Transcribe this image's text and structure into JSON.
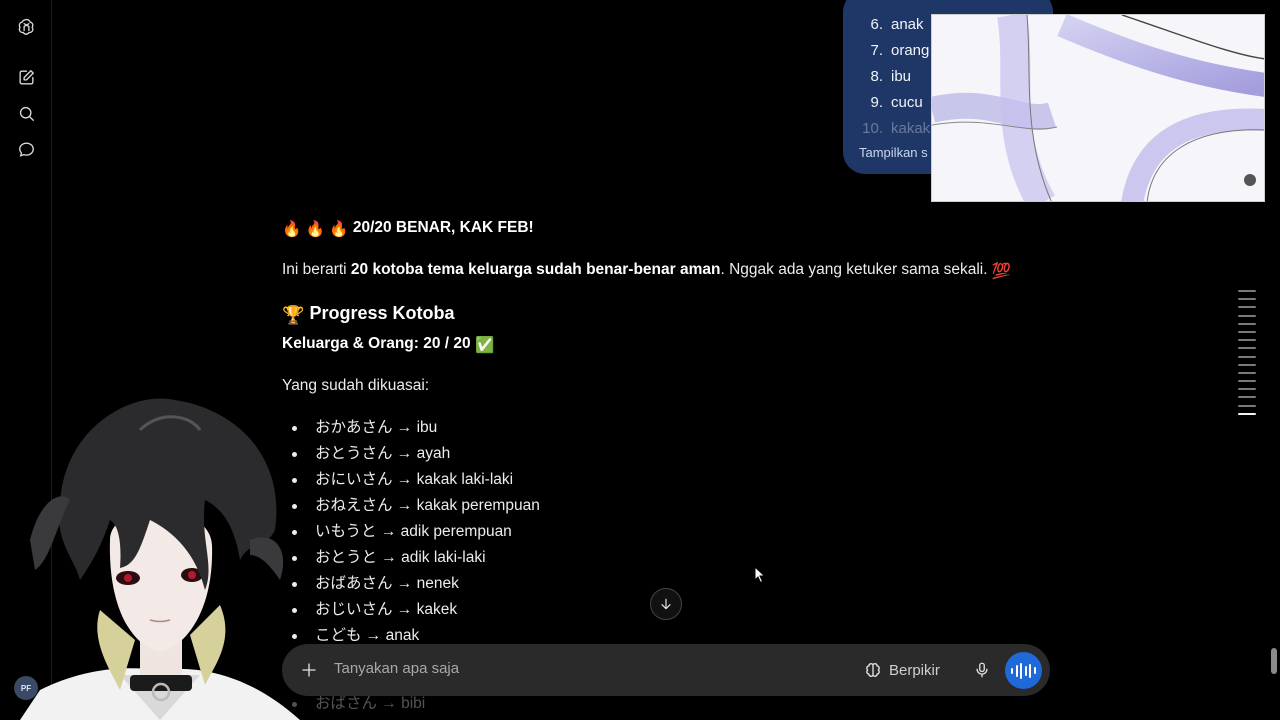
{
  "user_message": {
    "items": [
      {
        "n": "6.",
        "text": "anak"
      },
      {
        "n": "7.",
        "text": "orang t"
      },
      {
        "n": "8.",
        "text": "ibu"
      },
      {
        "n": "9.",
        "text": "cucu"
      },
      {
        "n": "10.",
        "text": "kakak l"
      }
    ],
    "show_more": "Tampilkan s"
  },
  "response": {
    "headline_emoji": "🔥 🔥 🔥",
    "headline": "20/20 BENAR, KAK FEB!",
    "para_prefix": "Ini berarti ",
    "para_bold": "20 kotoba tema keluarga sudah benar-benar aman",
    "para_suffix": ". Nggak ada yang ketuker sama sekali.",
    "para_emoji": "💯",
    "section_emoji": "🏆",
    "section_title": "Progress Kotoba",
    "subtitle": "Keluarga & Orang: 20 / 20",
    "subtitle_emoji": "✅",
    "mastered_label": "Yang sudah dikuasai:",
    "mastered": [
      "おかあさん → ibu",
      "おとうさん → ayah",
      "おにいさん → kakak laki-laki",
      "おねえさん → kakak perempuan",
      "いもうと → adik perempuan",
      "おとうと → adik laki-laki",
      "おばあさん → nenek",
      "おじいさん → kakek",
      "こども → anak",
      "おばさん → bibi"
    ]
  },
  "composer": {
    "placeholder": "Tanyakan apa saja",
    "think_label": "Berpikir",
    "avatar_initials": "PF"
  },
  "colors": {
    "background": "#000000",
    "user_bubble": "#1e3766",
    "composer": "#2a2a2a",
    "voice_button": "#1f6ad8"
  }
}
